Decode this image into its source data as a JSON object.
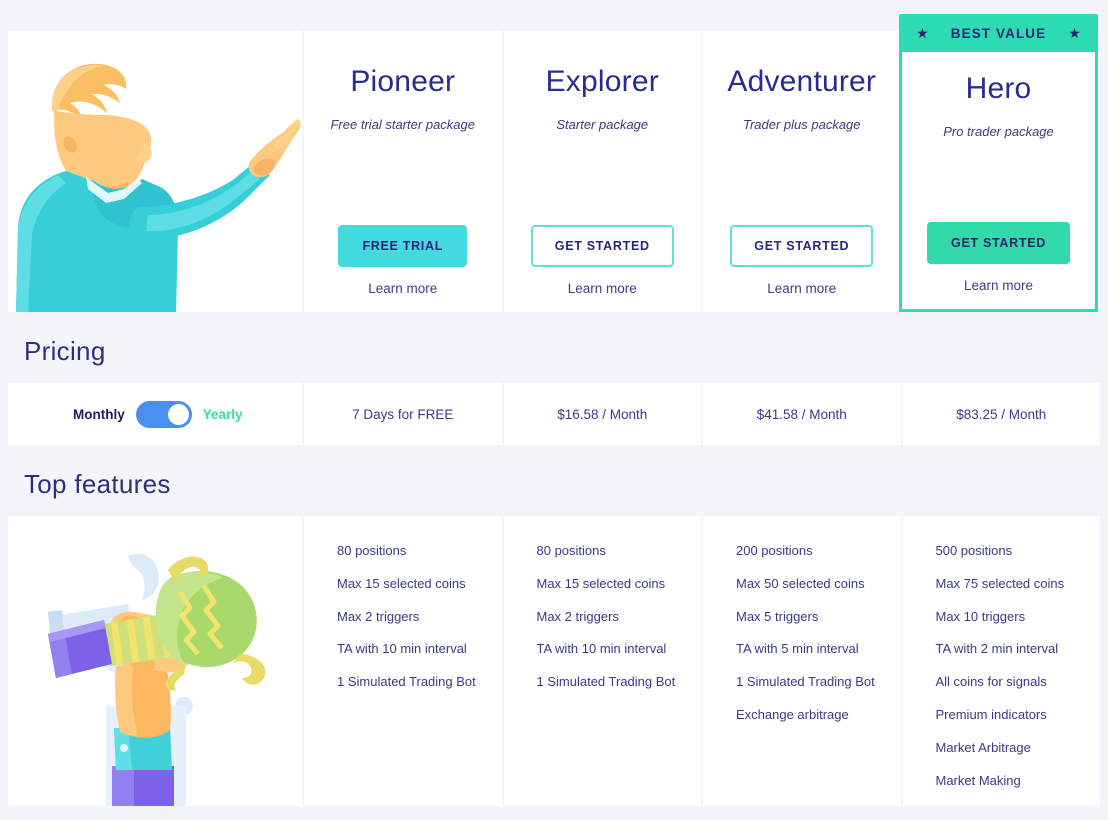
{
  "sections": {
    "pricing_title": "Pricing",
    "features_title": "Top features"
  },
  "badge": {
    "label": "BEST VALUE",
    "star_left": "★",
    "star_right": "★",
    "color": "#2edcb4"
  },
  "billing_toggle": {
    "monthly_label": "Monthly",
    "yearly_label": "Yearly",
    "selected": "Yearly",
    "track_color": "#4a8ef0",
    "active_label_color": "#2fe39b"
  },
  "plans": [
    {
      "name": "Pioneer",
      "subtitle": "Free trial starter package",
      "cta": "FREE TRIAL",
      "cta_style": "filled-cyan",
      "learn_more": "Learn more",
      "price": "7 Days for FREE",
      "featured": false,
      "features": [
        "80 positions",
        "Max 15 selected coins",
        "Max 2 triggers",
        "TA with 10 min interval",
        "1 Simulated Trading Bot"
      ]
    },
    {
      "name": "Explorer",
      "subtitle": "Starter package",
      "cta": "GET STARTED",
      "cta_style": "outline",
      "learn_more": "Learn more",
      "price": "$16.58 / Month",
      "featured": false,
      "features": [
        "80 positions",
        "Max 15 selected coins",
        "Max 2 triggers",
        "TA with 10 min interval",
        "1 Simulated Trading Bot"
      ]
    },
    {
      "name": "Adventurer",
      "subtitle": "Trader plus package",
      "cta": "GET STARTED",
      "cta_style": "outline",
      "learn_more": "Learn more",
      "price": "$41.58 / Month",
      "featured": false,
      "features": [
        "200 positions",
        "Max 50 selected coins",
        "Max 5 triggers",
        "TA with 5 min interval",
        "1 Simulated Trading Bot",
        "Exchange arbitrage"
      ]
    },
    {
      "name": "Hero",
      "subtitle": "Pro trader package",
      "cta": "GET STARTED",
      "cta_style": "filled-green",
      "learn_more": "Learn more",
      "price": "$83.25 / Month",
      "featured": true,
      "features": [
        "500 positions",
        "Max 75 selected coins",
        "Max 10 triggers",
        "TA with 2 min interval",
        "All coins for signals",
        "Premium indicators",
        "Market Arbitrage",
        "Market Making"
      ]
    }
  ],
  "illustrations": {
    "plans": "man-pointing-illustration",
    "features": "hand-holding-trophy-illustration"
  },
  "colors": {
    "page_background": "#f4f5fb",
    "card_background": "#ffffff",
    "heading": "#2f2f7e",
    "plan_name": "#2a2a8f",
    "body_text": "#3a3a85",
    "cyan": "#45d9e0",
    "green": "#2edcb4",
    "blue": "#4a8ef0"
  }
}
